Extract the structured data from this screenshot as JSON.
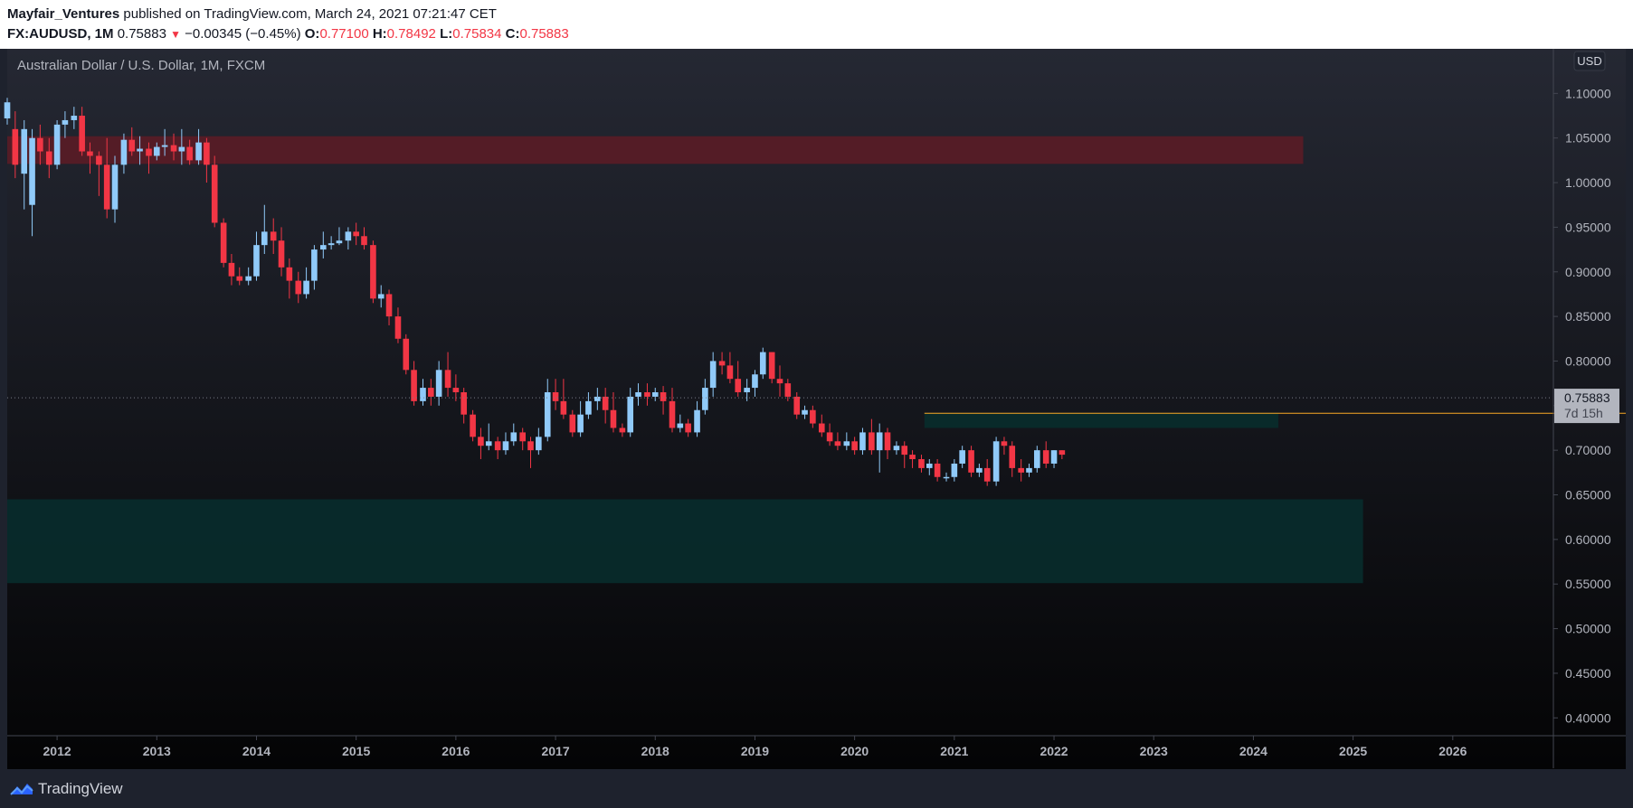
{
  "header": {
    "author": "Mayfair_Ventures",
    "published": "published on TradingView.com, March 24, 2021 07:21:47 CET",
    "symbol": "FX:AUDUSD, 1M",
    "last": "0.75883",
    "change_arrow": "▼",
    "change": "−0.00345 (−0.45%)",
    "o_label": "O:",
    "o_value": "0.77100",
    "h_label": "H:",
    "h_value": "0.78492",
    "l_label": "L:",
    "l_value": "0.75834",
    "c_label": "C:",
    "c_value": "0.75883"
  },
  "footer": {
    "brand": "TradingView",
    "logo_icon": "tradingview-logo-icon"
  },
  "colors": {
    "up": "#90caf9",
    "down": "#f23645",
    "resistance_zone": "#5a1c26",
    "support_zone": "#082c2c",
    "price_line": "#f9a825"
  },
  "chart_data": {
    "type": "candlestick",
    "title": "Australian Dollar / U.S. Dollar, 1M, FXCM",
    "currency": "USD",
    "x_ticks": [
      "2012",
      "2013",
      "2014",
      "2015",
      "2016",
      "2017",
      "2018",
      "2019",
      "2020",
      "2021",
      "2022",
      "2023",
      "2024",
      "2025",
      "2026"
    ],
    "y_ticks": [
      "0.40000",
      "0.45000",
      "0.50000",
      "0.55000",
      "0.60000",
      "0.65000",
      "0.70000",
      "0.75000",
      "0.80000",
      "0.85000",
      "0.90000",
      "0.95000",
      "1.00000",
      "1.05000",
      "1.10000"
    ],
    "ylim": [
      0.38,
      1.15
    ],
    "xlim": [
      2011.5,
      2027.0
    ],
    "grid": false,
    "current_price": {
      "value": 0.75883,
      "label": "0.75883",
      "countdown": "7d 15h"
    },
    "zones": [
      {
        "type": "resistance",
        "x_start": 2011.5,
        "x_end": 2024.5,
        "y_low": 1.021,
        "y_high": 1.052
      },
      {
        "type": "support",
        "x_start": 2011.5,
        "x_end": 2025.1,
        "y_low": 0.551,
        "y_high": 0.645
      },
      {
        "type": "support",
        "x_start": 2020.7,
        "x_end": 2024.25,
        "y_low": 0.725,
        "y_high": 0.742
      }
    ],
    "level_line": {
      "value": 0.7415,
      "x_start": 2020.7
    },
    "candles": [
      [
        2011.5,
        1.072,
        1.09,
        1.065,
        1.095
      ],
      [
        2011.58,
        1.06,
        1.02,
        1.005,
        1.08
      ],
      [
        2011.67,
        1.01,
        1.06,
        0.97,
        1.07
      ],
      [
        2011.75,
        0.975,
        1.05,
        0.94,
        1.06
      ],
      [
        2011.83,
        1.05,
        1.035,
        1.02,
        1.065
      ],
      [
        2011.92,
        1.035,
        1.02,
        1.005,
        1.05
      ],
      [
        2012.0,
        1.02,
        1.065,
        1.015,
        1.07
      ],
      [
        2012.08,
        1.065,
        1.07,
        1.05,
        1.08
      ],
      [
        2012.17,
        1.07,
        1.075,
        1.06,
        1.085
      ],
      [
        2012.25,
        1.075,
        1.035,
        1.03,
        1.085
      ],
      [
        2012.33,
        1.035,
        1.03,
        1.01,
        1.045
      ],
      [
        2012.42,
        1.03,
        1.02,
        0.985,
        1.035
      ],
      [
        2012.5,
        1.02,
        0.97,
        0.96,
        1.05
      ],
      [
        2012.58,
        0.97,
        1.02,
        0.955,
        1.03
      ],
      [
        2012.67,
        1.02,
        1.048,
        1.01,
        1.055
      ],
      [
        2012.75,
        1.048,
        1.035,
        1.03,
        1.062
      ],
      [
        2012.83,
        1.035,
        1.038,
        1.02,
        1.052
      ],
      [
        2012.92,
        1.038,
        1.03,
        1.01,
        1.045
      ],
      [
        2013.0,
        1.03,
        1.04,
        1.025,
        1.045
      ],
      [
        2013.08,
        1.04,
        1.042,
        1.03,
        1.06
      ],
      [
        2013.17,
        1.042,
        1.035,
        1.025,
        1.055
      ],
      [
        2013.25,
        1.035,
        1.04,
        1.02,
        1.06
      ],
      [
        2013.33,
        1.04,
        1.025,
        1.02,
        1.048
      ],
      [
        2013.42,
        1.025,
        1.045,
        1.02,
        1.06
      ],
      [
        2013.5,
        1.045,
        1.02,
        1.0,
        1.05
      ],
      [
        2013.58,
        1.02,
        0.955,
        0.95,
        1.03
      ],
      [
        2013.67,
        0.955,
        0.91,
        0.905,
        0.96
      ],
      [
        2013.75,
        0.91,
        0.895,
        0.885,
        0.92
      ],
      [
        2013.83,
        0.895,
        0.89,
        0.885,
        0.905
      ],
      [
        2013.92,
        0.89,
        0.895,
        0.885,
        0.905
      ],
      [
        2014.0,
        0.895,
        0.93,
        0.89,
        0.945
      ],
      [
        2014.08,
        0.93,
        0.945,
        0.92,
        0.975
      ],
      [
        2014.17,
        0.945,
        0.935,
        0.92,
        0.96
      ],
      [
        2014.25,
        0.935,
        0.905,
        0.895,
        0.95
      ],
      [
        2014.33,
        0.905,
        0.89,
        0.87,
        0.915
      ],
      [
        2014.42,
        0.89,
        0.875,
        0.865,
        0.9
      ],
      [
        2014.5,
        0.875,
        0.89,
        0.87,
        0.905
      ],
      [
        2014.58,
        0.89,
        0.925,
        0.88,
        0.93
      ],
      [
        2014.67,
        0.925,
        0.93,
        0.915,
        0.945
      ],
      [
        2014.75,
        0.93,
        0.932,
        0.925,
        0.94
      ],
      [
        2014.83,
        0.932,
        0.935,
        0.93,
        0.95
      ],
      [
        2014.92,
        0.935,
        0.945,
        0.925,
        0.95
      ],
      [
        2015.0,
        0.945,
        0.94,
        0.93,
        0.955
      ],
      [
        2015.08,
        0.94,
        0.93,
        0.925,
        0.95
      ],
      [
        2015.17,
        0.93,
        0.87,
        0.865,
        0.935
      ],
      [
        2015.25,
        0.87,
        0.875,
        0.86,
        0.885
      ],
      [
        2015.33,
        0.875,
        0.85,
        0.84,
        0.88
      ],
      [
        2015.42,
        0.85,
        0.825,
        0.82,
        0.86
      ],
      [
        2015.5,
        0.825,
        0.79,
        0.785,
        0.83
      ],
      [
        2015.58,
        0.79,
        0.755,
        0.75,
        0.8
      ],
      [
        2015.67,
        0.755,
        0.77,
        0.75,
        0.78
      ],
      [
        2015.75,
        0.77,
        0.76,
        0.75,
        0.78
      ],
      [
        2015.83,
        0.76,
        0.79,
        0.75,
        0.8
      ],
      [
        2015.92,
        0.79,
        0.77,
        0.76,
        0.81
      ],
      [
        2016.0,
        0.77,
        0.765,
        0.755,
        0.785
      ],
      [
        2016.08,
        0.765,
        0.74,
        0.73,
        0.77
      ],
      [
        2016.17,
        0.74,
        0.715,
        0.71,
        0.745
      ],
      [
        2016.25,
        0.715,
        0.705,
        0.69,
        0.725
      ],
      [
        2016.33,
        0.705,
        0.71,
        0.7,
        0.73
      ],
      [
        2016.42,
        0.71,
        0.7,
        0.69,
        0.715
      ],
      [
        2016.5,
        0.7,
        0.71,
        0.695,
        0.72
      ],
      [
        2016.58,
        0.71,
        0.72,
        0.705,
        0.73
      ],
      [
        2016.67,
        0.72,
        0.71,
        0.7,
        0.725
      ],
      [
        2016.75,
        0.71,
        0.7,
        0.68,
        0.715
      ],
      [
        2016.83,
        0.7,
        0.715,
        0.695,
        0.725
      ],
      [
        2016.92,
        0.715,
        0.765,
        0.71,
        0.78
      ],
      [
        2017.0,
        0.765,
        0.755,
        0.745,
        0.78
      ],
      [
        2017.08,
        0.755,
        0.74,
        0.735,
        0.78
      ],
      [
        2017.17,
        0.74,
        0.72,
        0.715,
        0.745
      ],
      [
        2017.25,
        0.72,
        0.74,
        0.715,
        0.755
      ],
      [
        2017.33,
        0.74,
        0.755,
        0.735,
        0.765
      ],
      [
        2017.42,
        0.755,
        0.76,
        0.745,
        0.77
      ],
      [
        2017.5,
        0.76,
        0.745,
        0.73,
        0.77
      ],
      [
        2017.58,
        0.745,
        0.725,
        0.72,
        0.765
      ],
      [
        2017.67,
        0.725,
        0.72,
        0.715,
        0.73
      ],
      [
        2017.75,
        0.72,
        0.76,
        0.715,
        0.77
      ],
      [
        2017.83,
        0.76,
        0.765,
        0.75,
        0.775
      ],
      [
        2017.92,
        0.765,
        0.76,
        0.75,
        0.775
      ],
      [
        2018.0,
        0.76,
        0.765,
        0.755,
        0.77
      ],
      [
        2018.08,
        0.765,
        0.755,
        0.74,
        0.772
      ],
      [
        2018.17,
        0.755,
        0.725,
        0.72,
        0.77
      ],
      [
        2018.25,
        0.725,
        0.73,
        0.72,
        0.74
      ],
      [
        2018.33,
        0.73,
        0.72,
        0.715,
        0.735
      ],
      [
        2018.42,
        0.72,
        0.745,
        0.715,
        0.755
      ],
      [
        2018.5,
        0.745,
        0.77,
        0.74,
        0.78
      ],
      [
        2018.58,
        0.77,
        0.8,
        0.76,
        0.81
      ],
      [
        2018.67,
        0.8,
        0.795,
        0.785,
        0.81
      ],
      [
        2018.75,
        0.795,
        0.78,
        0.775,
        0.81
      ],
      [
        2018.83,
        0.78,
        0.765,
        0.76,
        0.8
      ],
      [
        2018.92,
        0.765,
        0.77,
        0.755,
        0.78
      ],
      [
        2019.0,
        0.77,
        0.785,
        0.76,
        0.79
      ],
      [
        2019.08,
        0.785,
        0.81,
        0.78,
        0.815
      ],
      [
        2019.17,
        0.81,
        0.78,
        0.775,
        0.81
      ],
      [
        2019.25,
        0.78,
        0.775,
        0.76,
        0.795
      ],
      [
        2019.33,
        0.775,
        0.76,
        0.755,
        0.78
      ],
      [
        2019.42,
        0.76,
        0.74,
        0.735,
        0.765
      ],
      [
        2019.5,
        0.74,
        0.745,
        0.735,
        0.75
      ],
      [
        2019.58,
        0.745,
        0.73,
        0.725,
        0.75
      ],
      [
        2019.67,
        0.73,
        0.72,
        0.715,
        0.74
      ],
      [
        2019.75,
        0.72,
        0.71,
        0.705,
        0.73
      ],
      [
        2019.83,
        0.71,
        0.705,
        0.7,
        0.72
      ],
      [
        2019.92,
        0.705,
        0.71,
        0.7,
        0.72
      ],
      [
        2020.0,
        0.71,
        0.7,
        0.695,
        0.715
      ],
      [
        2020.08,
        0.7,
        0.72,
        0.695,
        0.725
      ],
      [
        2020.17,
        0.72,
        0.7,
        0.695,
        0.735
      ],
      [
        2020.25,
        0.7,
        0.72,
        0.675,
        0.73
      ],
      [
        2020.33,
        0.72,
        0.7,
        0.69,
        0.725
      ],
      [
        2020.42,
        0.7,
        0.705,
        0.695,
        0.71
      ],
      [
        2020.5,
        0.705,
        0.695,
        0.68,
        0.71
      ],
      [
        2020.58,
        0.695,
        0.69,
        0.68,
        0.7
      ],
      [
        2020.67,
        0.69,
        0.68,
        0.675,
        0.695
      ],
      [
        2020.75,
        0.68,
        0.685,
        0.672,
        0.69
      ],
      [
        2020.83,
        0.685,
        0.67,
        0.665,
        0.69
      ],
      [
        2020.92,
        0.67,
        0.67,
        0.665,
        0.675
      ],
      [
        2021.0,
        0.67,
        0.685,
        0.665,
        0.69
      ],
      [
        2021.08,
        0.685,
        0.7,
        0.68,
        0.705
      ],
      [
        2021.17,
        0.7,
        0.675,
        0.67,
        0.705
      ],
      [
        2021.25,
        0.675,
        0.68,
        0.67,
        0.685
      ],
      [
        2021.33,
        0.68,
        0.665,
        0.66,
        0.69
      ],
      [
        2021.42,
        0.665,
        0.71,
        0.66,
        0.715
      ],
      [
        2021.5,
        0.71,
        0.705,
        0.695,
        0.715
      ],
      [
        2021.58,
        0.705,
        0.68,
        0.67,
        0.71
      ],
      [
        2021.67,
        0.68,
        0.675,
        0.665,
        0.69
      ],
      [
        2021.75,
        0.675,
        0.68,
        0.67,
        0.685
      ],
      [
        2021.83,
        0.68,
        0.7,
        0.675,
        0.705
      ],
      [
        2021.92,
        0.7,
        0.685,
        0.68,
        0.71
      ],
      [
        2022.0,
        0.685,
        0.7,
        0.68,
        0.7
      ],
      [
        2022.08,
        0.7,
        0.695,
        0.69,
        0.7
      ]
    ]
  }
}
